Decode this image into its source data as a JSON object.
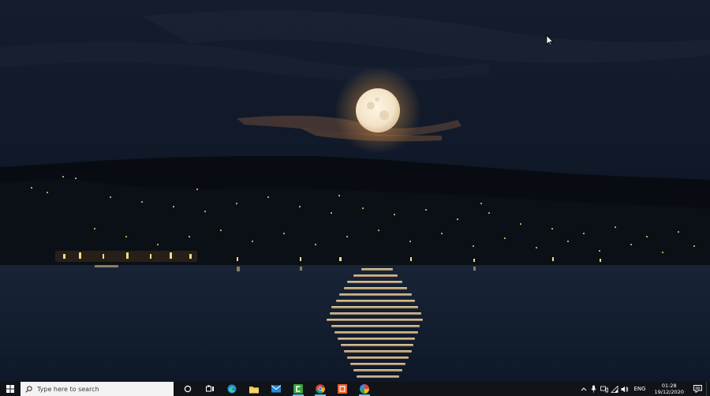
{
  "wallpaper": {
    "description_icon": "full-moon-over-lake-night-wallpaper"
  },
  "taskbar": {
    "start_icon": "windows-logo-icon",
    "search": {
      "placeholder": "Type here to search",
      "icon": "search-icon"
    },
    "pinned": [
      {
        "name": "cortana-icon"
      },
      {
        "name": "task-view-icon"
      },
      {
        "name": "edge-icon"
      },
      {
        "name": "file-explorer-icon"
      },
      {
        "name": "mail-icon"
      },
      {
        "name": "camtasia-icon"
      },
      {
        "name": "chrome-icon"
      },
      {
        "name": "office-icon"
      },
      {
        "name": "colorful-app-icon"
      }
    ],
    "tray": {
      "language": "ENG",
      "time": "01:28",
      "date": "19/12/2020"
    },
    "colors": {
      "taskbar_bg": "#101418",
      "search_bg": "#f3f3f3",
      "active_indicator": "#7bb7e6"
    }
  }
}
